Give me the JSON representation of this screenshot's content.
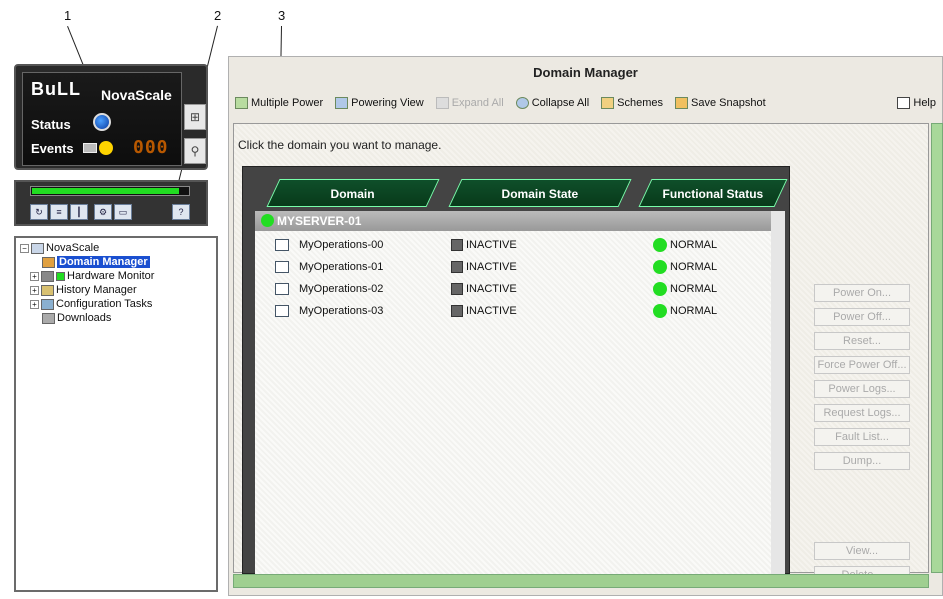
{
  "callouts": [
    "1",
    "2",
    "3"
  ],
  "status_panel": {
    "brand": "BuLL",
    "product": "NovaScale",
    "status_label": "Status",
    "events_label": "Events",
    "events_counter": "000"
  },
  "progress": {
    "value_pct": 93,
    "color": "#22dd22"
  },
  "tree": {
    "items": [
      {
        "label": "NovaScale"
      },
      {
        "label": "Domain Manager"
      },
      {
        "label": "Hardware Monitor"
      },
      {
        "label": "History Manager"
      },
      {
        "label": "Configuration Tasks"
      },
      {
        "label": "Downloads"
      }
    ]
  },
  "window": {
    "title": "Domain Manager",
    "toolbar": {
      "multiple_power": "Multiple Power",
      "powering_view": "Powering View",
      "expand_all": "Expand All",
      "collapse_all": "Collapse All",
      "schemes": "Schemes",
      "save_snapshot": "Save Snapshot",
      "help": "Help"
    },
    "instruction": "Click the domain you want to manage.",
    "columns": [
      "Domain",
      "Domain State",
      "Functional Status"
    ],
    "server": "MYSERVER-01",
    "domains": [
      {
        "name": "MyOperations-00",
        "state": "INACTIVE",
        "func": "NORMAL"
      },
      {
        "name": "MyOperations-01",
        "state": "INACTIVE",
        "func": "NORMAL"
      },
      {
        "name": "MyOperations-02",
        "state": "INACTIVE",
        "func": "NORMAL"
      },
      {
        "name": "MyOperations-03",
        "state": "INACTIVE",
        "func": "NORMAL"
      }
    ],
    "actions": [
      "Power On...",
      "Power Off...",
      "Reset...",
      "Force Power Off...",
      "Power Logs...",
      "Request Logs...",
      "Fault List...",
      "Dump...",
      "View...",
      "Delete..."
    ]
  }
}
